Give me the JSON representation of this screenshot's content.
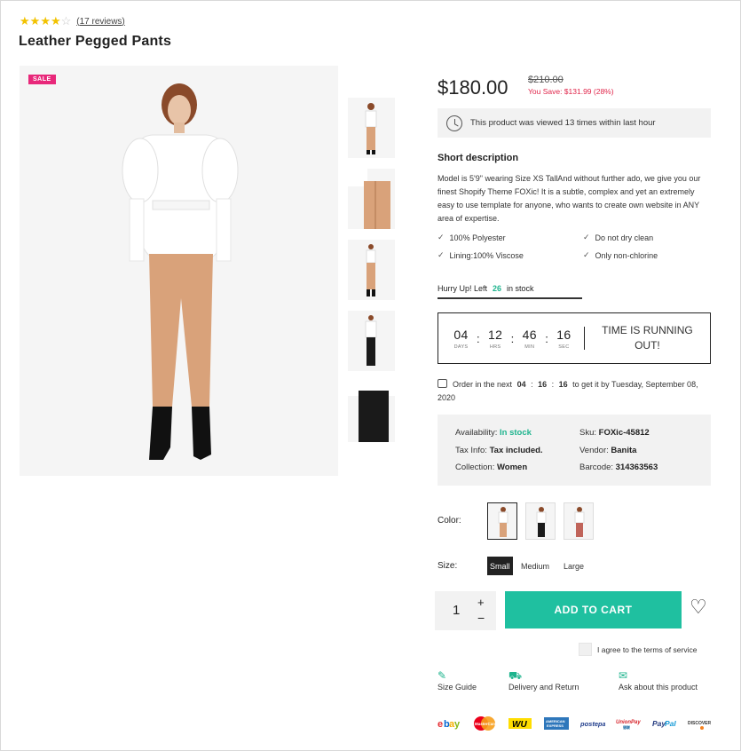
{
  "rating": {
    "stars_filled": 4,
    "stars_total": 5,
    "reviews_label": "(17 reviews)"
  },
  "product": {
    "title": "Leather Pegged Pants",
    "sale_badge": "SALE",
    "price": "$180.00",
    "old_price": "$210.00",
    "you_save": "You Save: $131.99 (28%)"
  },
  "viewed_notice": "This product was viewed 13 times within last hour",
  "short_description": {
    "heading": "Short description",
    "text": "Model is 5'9\" wearing Size XS TallAnd without further ado, we give you our finest Shopify Theme FOXic! It is a subtle, complex and yet an extremely easy to use template for anyone, who wants to create own website in ANY area of expertise.",
    "features": [
      "100% Polyester",
      "Do not dry clean",
      "Lining:100% Viscose",
      "Only non-chlorine"
    ]
  },
  "stock": {
    "prefix": "Hurry Up! Left",
    "count": "26",
    "suffix": "in stock",
    "level_fraction": 0.52
  },
  "countdown": {
    "days": "04",
    "days_label": "DAYS",
    "hours": "12",
    "hours_label": "HRS",
    "minutes": "46",
    "minutes_label": "MIN",
    "seconds": "16",
    "seconds_label": "SEC",
    "message": "TIME IS RUNNING OUT!"
  },
  "delivery": {
    "prefix": "Order in the next",
    "h": "04",
    "m": "16",
    "s": "16",
    "suffix": "to get it by Tuesday, September 08, 2020"
  },
  "info": {
    "availability_label": "Availability:",
    "availability_value": "In stock",
    "sku_label": "Sku:",
    "sku_value": "FOXic-45812",
    "tax_label": "Tax Info:",
    "tax_value": "Tax included.",
    "vendor_label": "Vendor:",
    "vendor_value": "Banita",
    "collection_label": "Collection:",
    "collection_value": "Women",
    "barcode_label": "Barcode:",
    "barcode_value": "314363563"
  },
  "options": {
    "color_label": "Color:",
    "size_label": "Size:",
    "sizes": [
      "Small",
      "Medium",
      "Large"
    ],
    "selected_size": "Small"
  },
  "cart": {
    "quantity": "1",
    "plus": "+",
    "minus": "−",
    "add_label": "ADD TO CART"
  },
  "terms_label": "I agree to the terms of service",
  "links": [
    "Size Guide",
    "Delivery and Return",
    "Ask about this product"
  ],
  "payments": [
    "ebay",
    "MasterCard",
    "WU",
    "AMERICAN EXPRESS",
    "postepay",
    "UnionPay",
    "PayPal",
    "DISCOVER"
  ],
  "colors": {
    "accent": "#1fc0a0",
    "sale": "#e8287a",
    "save_red": "#e0254a",
    "stars": "#f2c200"
  }
}
